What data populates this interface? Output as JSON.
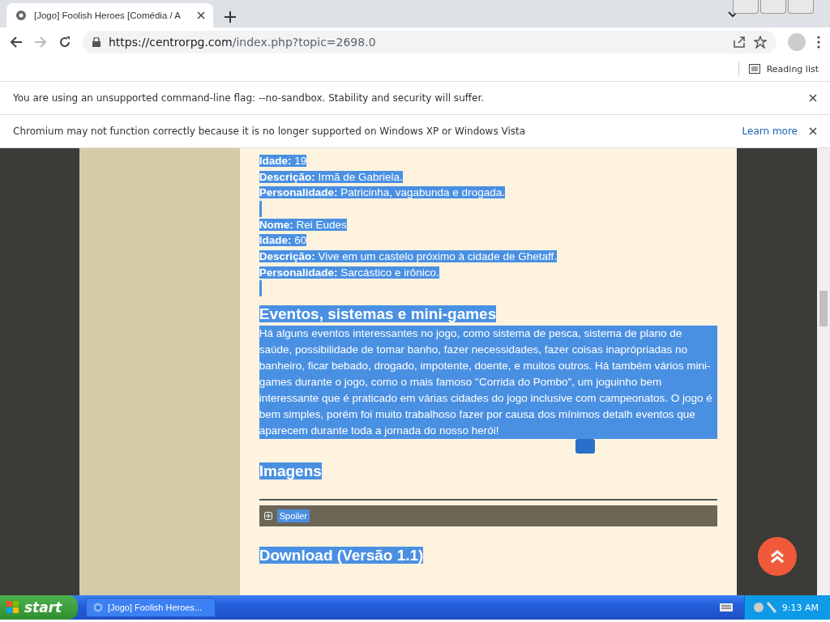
{
  "browser": {
    "tab_title": "[Jogo] Foolish Heroes [Comédia / A",
    "url_host": "https://centrorpg.com",
    "url_path": "/index.php?topic=2698.0",
    "reading_list": "Reading list"
  },
  "infobars": [
    {
      "text": "You are using an unsupported command-line flag: --no-sandbox. Stability and security will suffer."
    },
    {
      "text": "Chromium may not function correctly because it is no longer supported on Windows XP or Windows Vista",
      "link": "Learn more"
    }
  ],
  "characters": [
    [
      {
        "label": "Idade:",
        "value": "19"
      },
      {
        "label": "Descrição:",
        "value": "Irmã de Gabriela."
      },
      {
        "label": "Personalidade:",
        "value": "Patricinha, vagabunda e drogada."
      }
    ],
    [
      {
        "label": "Nome:",
        "value": "Rei Eudes"
      },
      {
        "label": "Idade:",
        "value": "60"
      },
      {
        "label": "Descrição:",
        "value": "Vive em um castelo próximo à cidade de Ghetaff."
      },
      {
        "label": "Personalidade:",
        "value": "Sarcástico e irônico."
      }
    ]
  ],
  "sections": [
    {
      "heading": "Eventos, sistemas e mini-games",
      "paragraph": "Há alguns eventos interessantes no jogo, como sistema de pesca, sistema de plano de saúde, possibilidade de tomar banho, fazer necessidades, fazer coisas inaprópriadas no banheiro, ficar bebado, drogado, impotente, doente, e muitos outros. Há também vários mini-games durante o jogo, como o mais famoso \"Corrida do Pombo\", um joguinho bem interessante que é praticado em várias cidades do jogo inclusive com campeonatos. O jogo é bem simples, porém foi muito trabalhoso fazer por causa dos mínimos detalh eventos que aparecem durante toda a jornada do nosso herói!"
    },
    {
      "heading": "Imagens",
      "spoiler": "Spoiler"
    },
    {
      "heading": "Download (Versão 1.1)"
    }
  ],
  "taskbar": {
    "start": "start",
    "task": "[Jogo] Foolish Heroes...",
    "time": "9:13 AM"
  }
}
